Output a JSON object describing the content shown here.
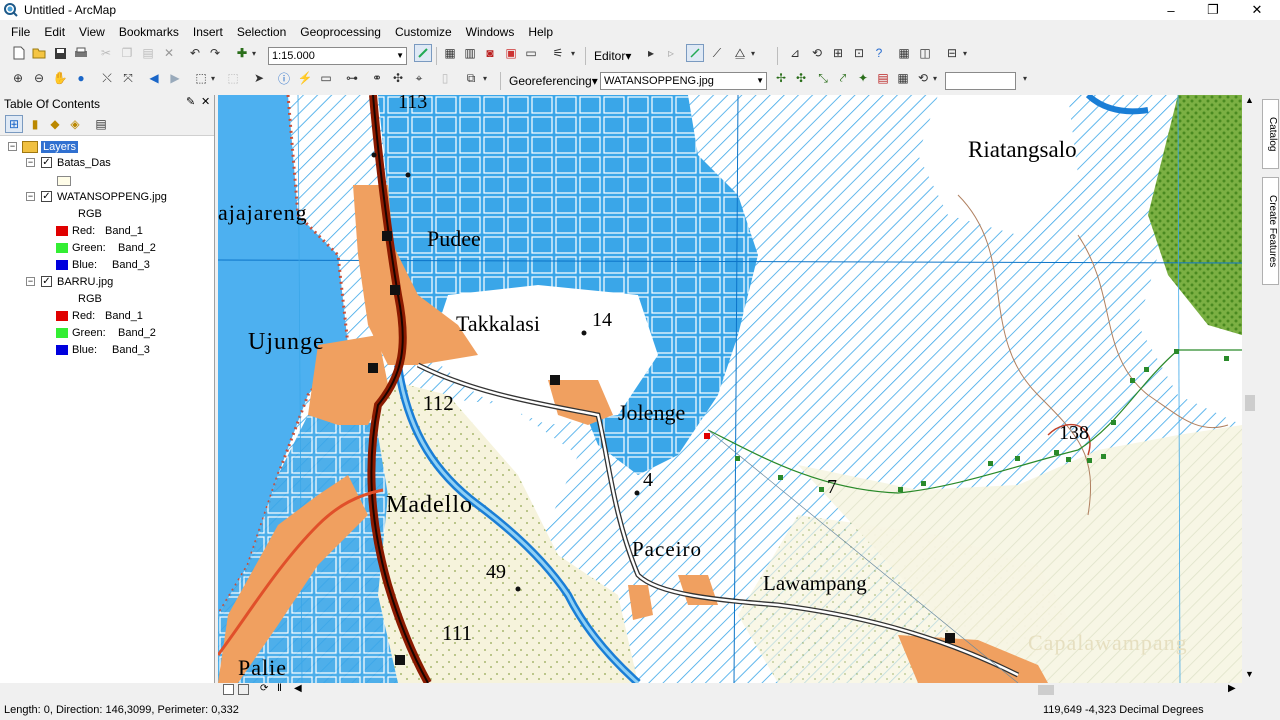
{
  "window": {
    "title": "Untitled - ArcMap",
    "minimize": "–",
    "restore": "❐",
    "close": "✕"
  },
  "menu": [
    "File",
    "Edit",
    "View",
    "Bookmarks",
    "Insert",
    "Selection",
    "Geoprocessing",
    "Customize",
    "Windows",
    "Help"
  ],
  "toolbar": {
    "scale_value": "1:15.000",
    "editor_label": "Editor▾",
    "georef_label": "Georeferencing▾",
    "georef_layer": "WATANSOPPENG.jpg",
    "georef_input": ""
  },
  "toc": {
    "title": "Table Of Contents",
    "pin": "ꟸ",
    "close": "✕",
    "root": "Layers",
    "layers": [
      {
        "name": "Batas_Das",
        "checked": true
      },
      {
        "name": "WATANSOPPENG.jpg",
        "checked": true,
        "rgb": "RGB",
        "bands": [
          {
            "ch": "Red:",
            "band": "Band_1",
            "color": "#e00000"
          },
          {
            "ch": "Green:",
            "band": "Band_2",
            "color": "#33ee33"
          },
          {
            "ch": "Blue:",
            "band": "Band_3",
            "color": "#0000dd"
          }
        ]
      },
      {
        "name": "BARRU.jpg",
        "checked": true,
        "rgb": "RGB",
        "bands": [
          {
            "ch": "Red:",
            "band": "Band_1",
            "color": "#e00000"
          },
          {
            "ch": "Green:",
            "band": "Band_2",
            "color": "#33ee33"
          },
          {
            "ch": "Blue:",
            "band": "Band_3",
            "color": "#0000dd"
          }
        ]
      }
    ]
  },
  "map_labels": {
    "l113": "113",
    "rajajareng": "ajajareng",
    "pudee": "Pudee",
    "takkalasi": "Takkalasi",
    "l14": "14",
    "ujunge": "Ujunge",
    "l112": "112",
    "jolenge": "Jolenge",
    "l4": "4",
    "madello": "Madello",
    "paceiro": "Paceiro",
    "l49": "49",
    "l111": "111",
    "palie": "Palie",
    "lawampang": "Lawampang",
    "capalawampang": "Capalawampang",
    "riatangsalo": "Riatangsalo",
    "l138": "138",
    "l7": "7"
  },
  "right_tabs": {
    "catalog": "Catalog",
    "create_features": "Create Features"
  },
  "status": {
    "left": "Length: 0, Direction: 146,3099, Perimeter: 0,332",
    "right": "119,649  -4,323 Decimal Degrees"
  },
  "colors": {
    "water": "#3aa6e8",
    "road": "#8b1a00",
    "settlement": "#f0a060",
    "grid": "#0c74c8"
  }
}
